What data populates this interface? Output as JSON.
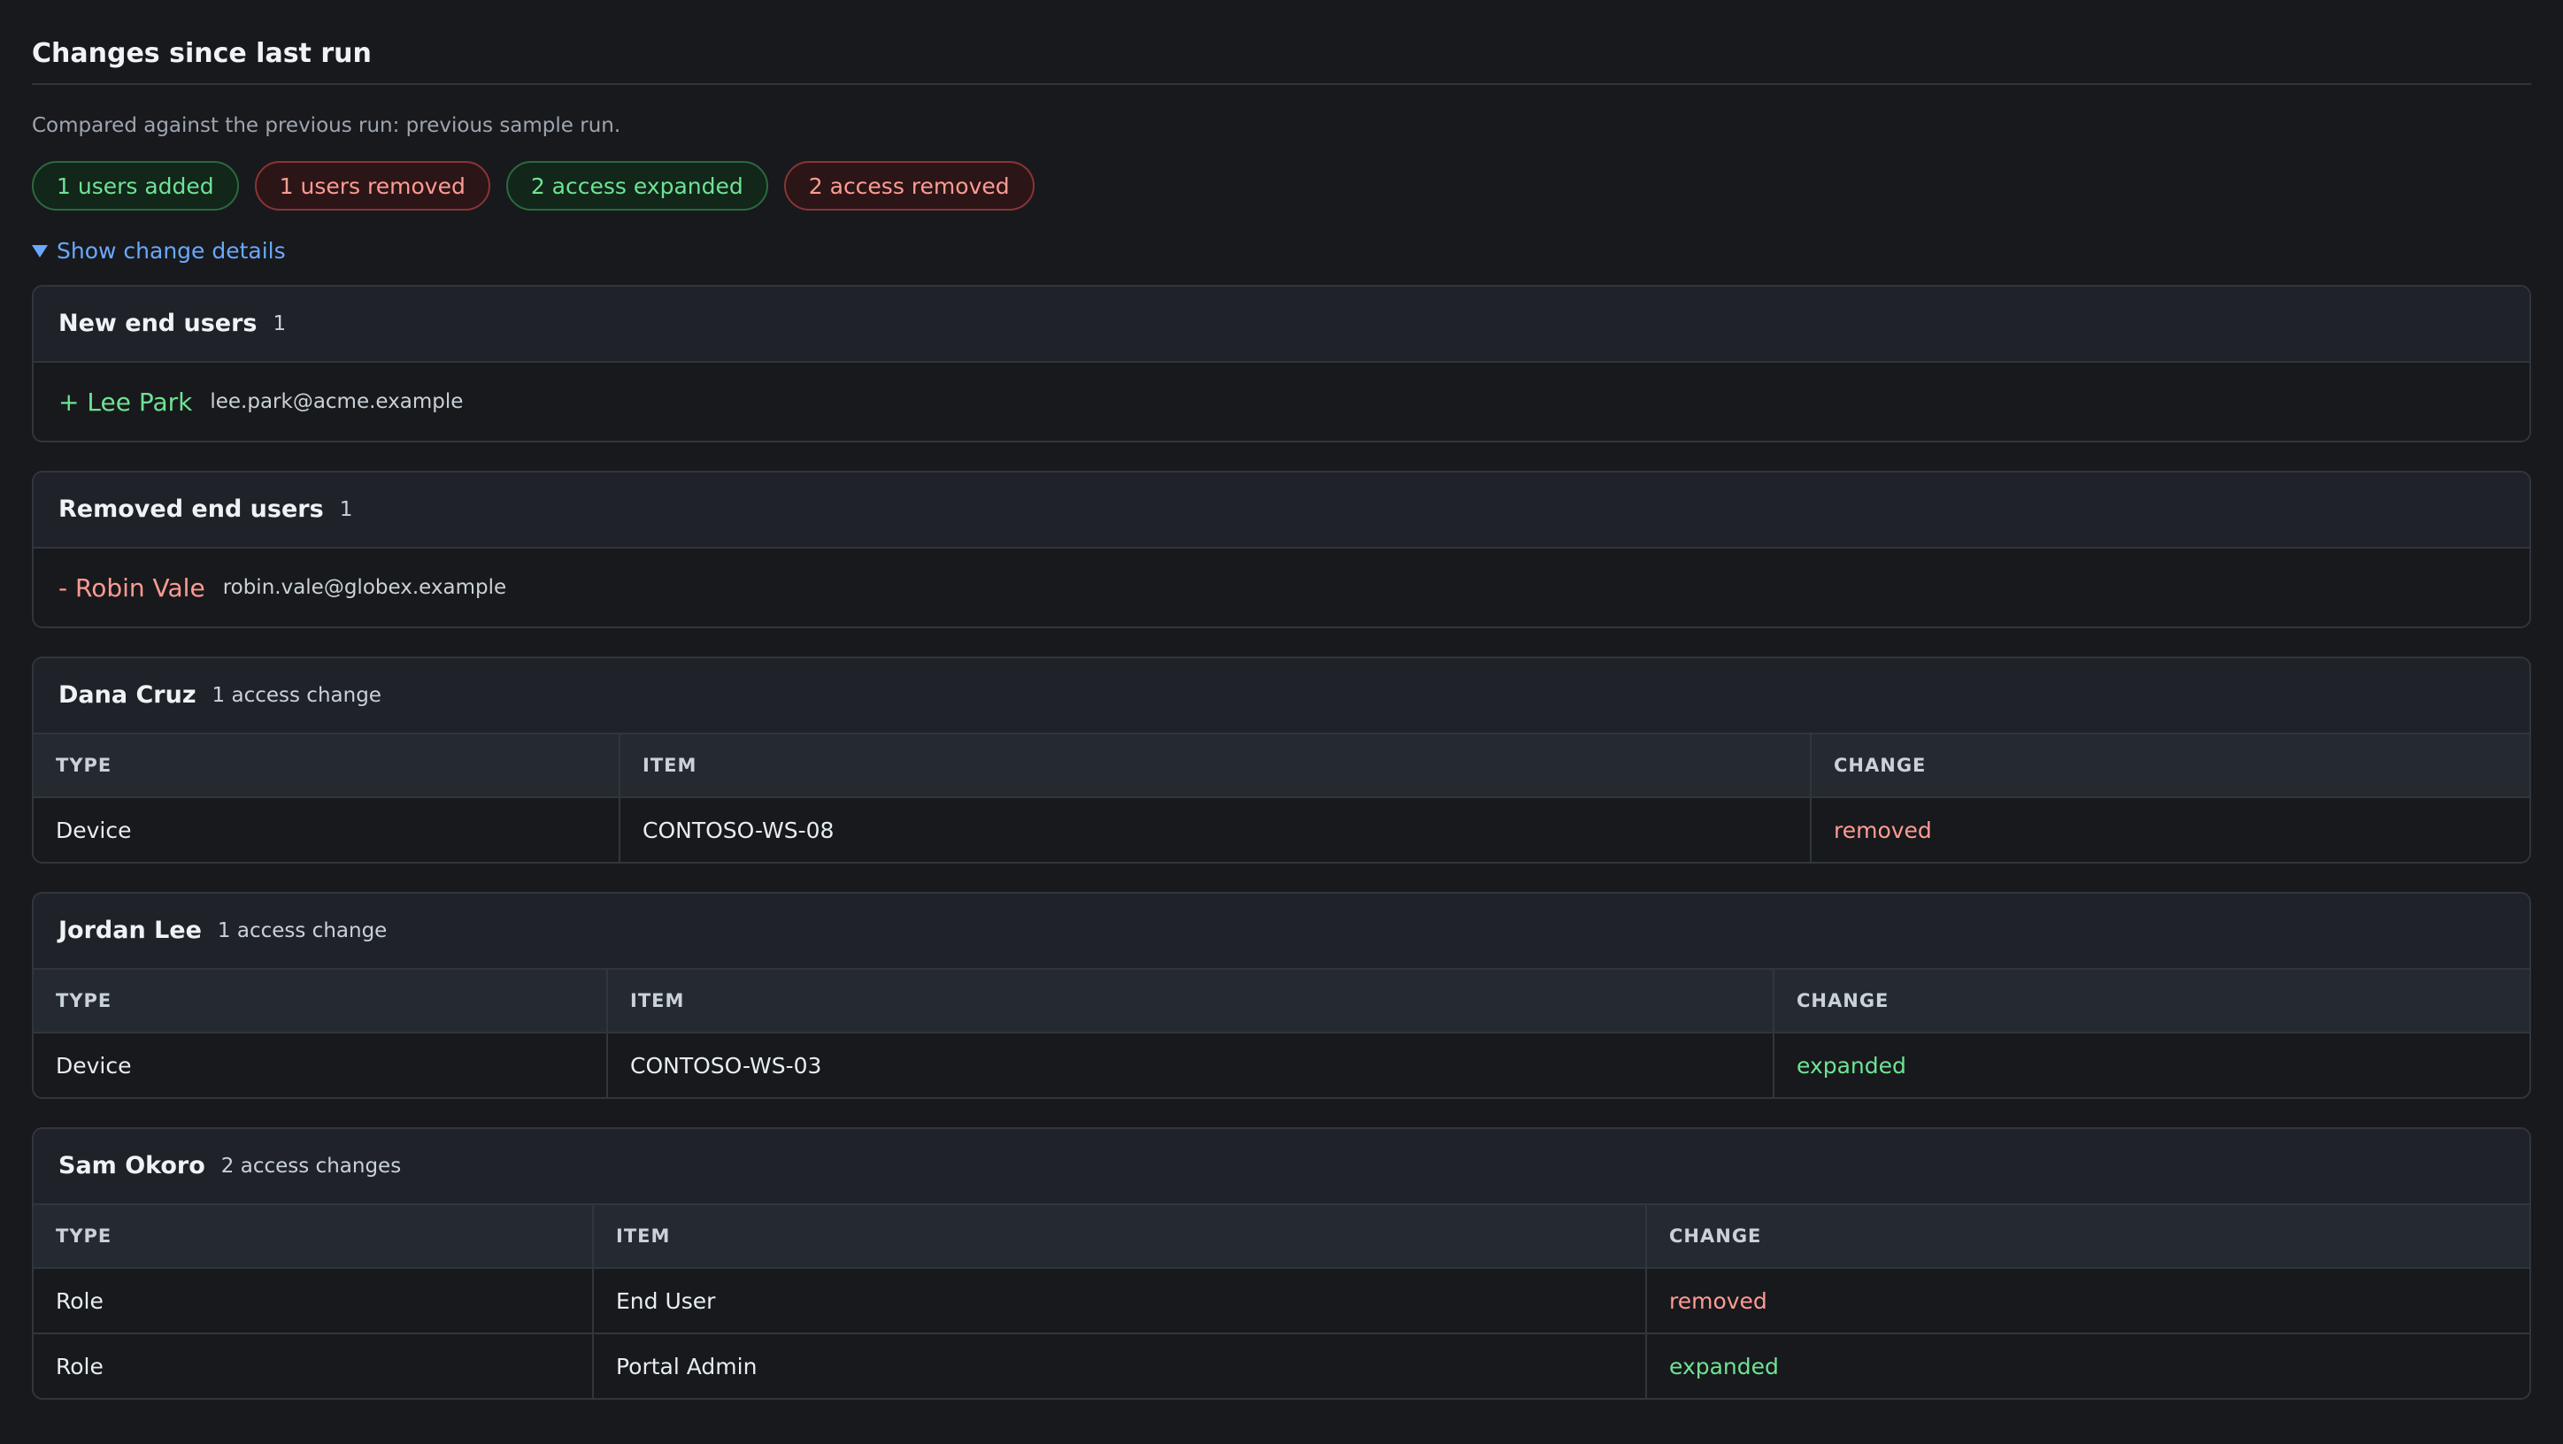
{
  "header": {
    "title": "Changes since last run",
    "subtitle": "Compared against the previous run: previous sample run."
  },
  "summary": {
    "users_added": "1 users added",
    "users_removed": "1 users removed",
    "access_expanded": "2 access expanded",
    "access_removed": "2 access removed"
  },
  "details_toggle": "Show change details",
  "new_users": {
    "title": "New end users",
    "count": "1",
    "items": [
      {
        "name": "+ Lee Park",
        "email": "lee.park@acme.example"
      }
    ]
  },
  "removed_users": {
    "title": "Removed end users",
    "count": "1",
    "items": [
      {
        "name": "- Robin Vale",
        "email": "robin.vale@globex.example"
      }
    ]
  },
  "access_changes": {
    "columns": [
      "TYPE",
      "ITEM",
      "CHANGE"
    ],
    "users": [
      {
        "name": "Dana Cruz",
        "count": "1 access change",
        "rows": [
          {
            "type": "Device",
            "item": "CONTOSO-WS-08",
            "change": "removed"
          }
        ]
      },
      {
        "name": "Jordan Lee",
        "count": "1 access change",
        "rows": [
          {
            "type": "Device",
            "item": "CONTOSO-WS-03",
            "change": "expanded"
          }
        ]
      },
      {
        "name": "Sam Okoro",
        "count": "2 access changes",
        "rows": [
          {
            "type": "Role",
            "item": "End User",
            "change": "removed"
          },
          {
            "type": "Role",
            "item": "Portal Admin",
            "change": "expanded"
          }
        ]
      }
    ]
  },
  "colors": {
    "added": "#6ee394",
    "removed": "#ff9b93",
    "link": "#6aa8ff",
    "background": "#18191c"
  }
}
